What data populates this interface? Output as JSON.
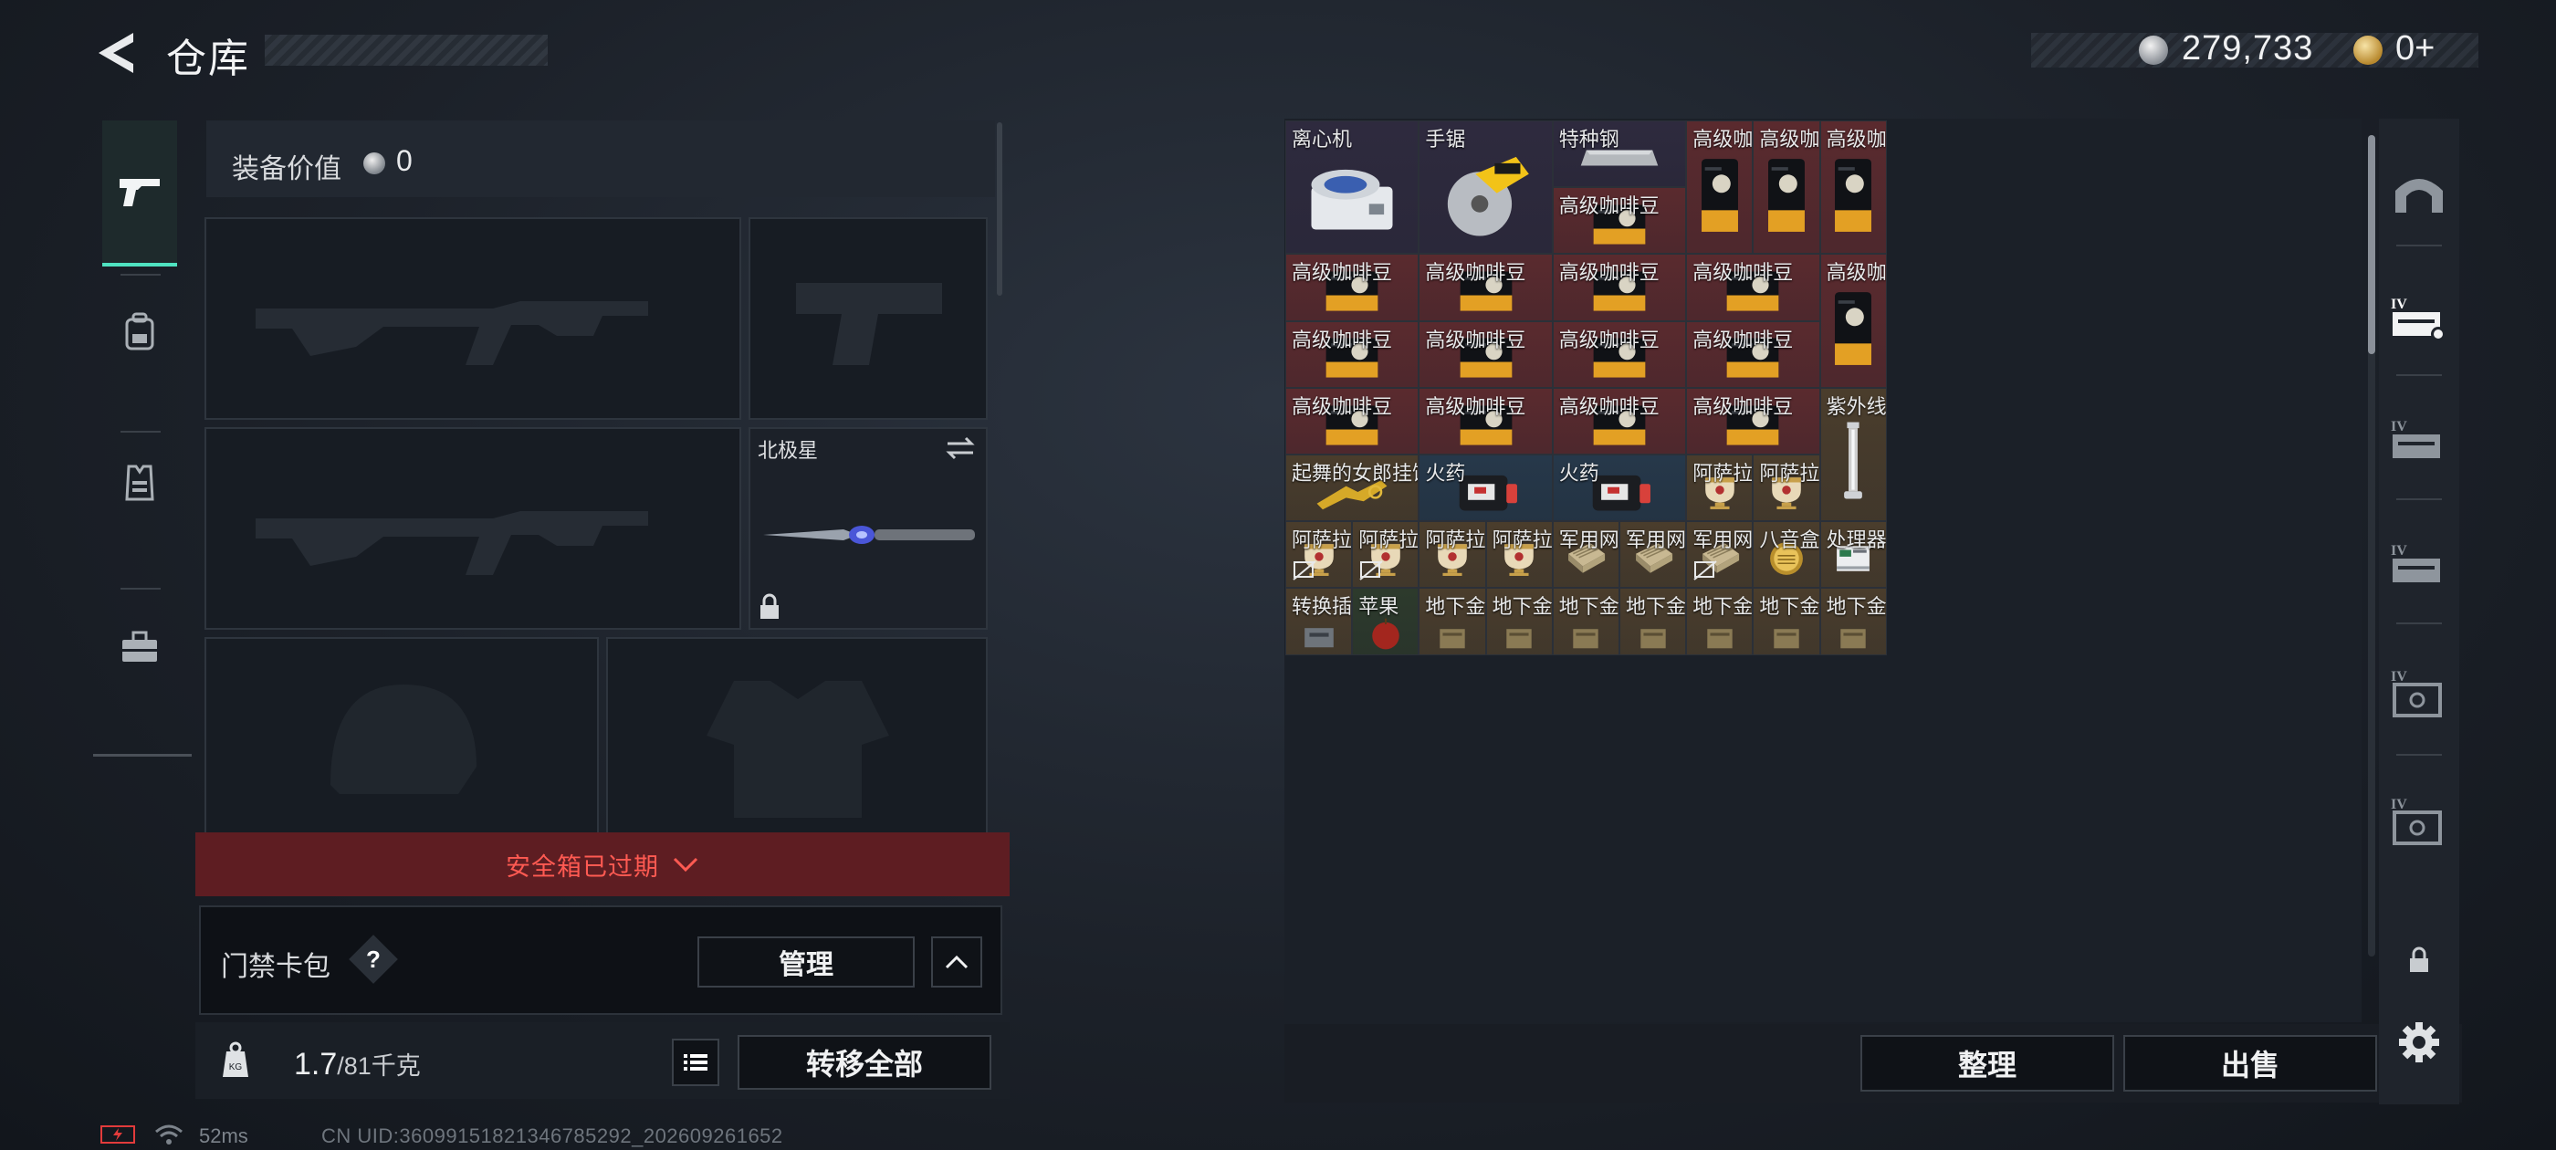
{
  "header": {
    "title": "仓库",
    "currency_value": "279,733",
    "tokens_value": "0+"
  },
  "categories": [
    {
      "icon": "pistol-icon",
      "active": true
    },
    {
      "icon": "backpack-icon",
      "active": false
    },
    {
      "icon": "vest-icon",
      "active": false
    },
    {
      "icon": "toolbox-icon",
      "active": false
    }
  ],
  "loadout": {
    "equipment_value_label": "装备价值",
    "equipment_value": "0",
    "melee_label": "北极星",
    "safe_box_banner": "安全箱已过期",
    "keycard_label": "门禁卡包",
    "keycard_help": "?",
    "manage_label": "管理",
    "weight_value": "1.7",
    "weight_max": "/81千克",
    "transfer_all_label": "转移全部"
  },
  "status": {
    "ping": "52ms",
    "uid": "CN UID:3609915182134678529​2_202609261652"
  },
  "grid": {
    "items": [
      {
        "name": "离心机",
        "icon": "centrifuge"
      },
      {
        "name": "手锯",
        "icon": "circular-saw"
      },
      {
        "name": "特种钢",
        "icon": "steel-bar"
      },
      {
        "name": "高级咖啡豆",
        "icon": "coffee-bag-vertical"
      },
      {
        "name": "高级咖啡豆",
        "icon": "coffee-bag-vertical"
      },
      {
        "name": "高级咖啡豆",
        "icon": "coffee-bag-vertical"
      },
      {
        "name": "高级咖啡豆",
        "icon": "coffee-bag"
      },
      {
        "name": "高级咖啡豆",
        "icon": "coffee-bag"
      },
      {
        "name": "高级咖啡豆",
        "icon": "coffee-bag"
      },
      {
        "name": "高级咖啡豆",
        "icon": "coffee-bag"
      },
      {
        "name": "高级咖啡豆",
        "icon": "coffee-bag"
      },
      {
        "name": "高级咖啡豆",
        "icon": "coffee-bag-vertical"
      },
      {
        "name": "高级咖啡豆",
        "icon": "coffee-bag"
      },
      {
        "name": "高级咖啡豆",
        "icon": "coffee-bag"
      },
      {
        "name": "高级咖啡豆",
        "icon": "coffee-bag"
      },
      {
        "name": "高级咖啡豆",
        "icon": "coffee-bag"
      },
      {
        "name": "高级咖啡豆",
        "icon": "coffee-bag"
      },
      {
        "name": "高级咖啡豆",
        "icon": "coffee-bag"
      },
      {
        "name": "高级咖啡豆",
        "icon": "coffee-bag"
      },
      {
        "name": "高级咖啡豆",
        "icon": "coffee-bag"
      },
      {
        "name": "紫外线灯",
        "icon": "uv-lamp"
      },
      {
        "name": "起舞的女郎挂饰",
        "icon": "dancer-ornament"
      },
      {
        "name": "火药",
        "icon": "gunpowder"
      },
      {
        "name": "火药",
        "icon": "gunpowder"
      },
      {
        "name": "阿萨拉酒杯",
        "icon": "gold-cup"
      },
      {
        "name": "阿萨拉酒杯",
        "icon": "gold-cup"
      },
      {
        "name": "阿萨拉酒杯",
        "icon": "gold-cup"
      },
      {
        "name": "阿萨拉酒杯",
        "icon": "gold-cup"
      },
      {
        "name": "阿萨拉酒杯",
        "icon": "gold-cup"
      },
      {
        "name": "阿萨拉酒杯",
        "icon": "gold-cup"
      },
      {
        "name": "军用网络...",
        "icon": "network-module"
      },
      {
        "name": "军用网络...",
        "icon": "network-module"
      },
      {
        "name": "军用网络...",
        "icon": "network-module"
      },
      {
        "name": "八音盒",
        "icon": "music-box"
      },
      {
        "name": "处理器",
        "icon": "processor"
      },
      {
        "name": "转换插座",
        "icon": "adapter"
      },
      {
        "name": "苹果",
        "icon": "apple"
      },
      {
        "name": "地下金库...",
        "icon": "vault-item"
      },
      {
        "name": "地下金库...",
        "icon": "vault-item"
      },
      {
        "name": "地下金库...",
        "icon": "vault-item"
      },
      {
        "name": "地下金库...",
        "icon": "vault-item"
      },
      {
        "name": "地下金库...",
        "icon": "vault-item"
      },
      {
        "name": "地下金库...",
        "icon": "vault-item"
      },
      {
        "name": "地下金库...",
        "icon": "vault-item"
      }
    ]
  },
  "actions": {
    "sort_label": "整理",
    "sell_label": "出售"
  },
  "sidebar": {
    "icons": [
      "vault-icon",
      "tier-iv-case-selected-icon",
      "tier-iv-case-icon",
      "tier-iv-case-icon",
      "tier-iv-safe-icon",
      "tier-iv-safe-icon",
      "lock-icon",
      "settings-icon"
    ]
  },
  "colors": {
    "accent": "#4fe3c1",
    "rarity_red": "#5a2a2e",
    "rarity_gold": "#4a3d2c",
    "rarity_blue": "#26384a",
    "rarity_purple": "#2e2a3e",
    "danger_text": "#ff5a52"
  }
}
